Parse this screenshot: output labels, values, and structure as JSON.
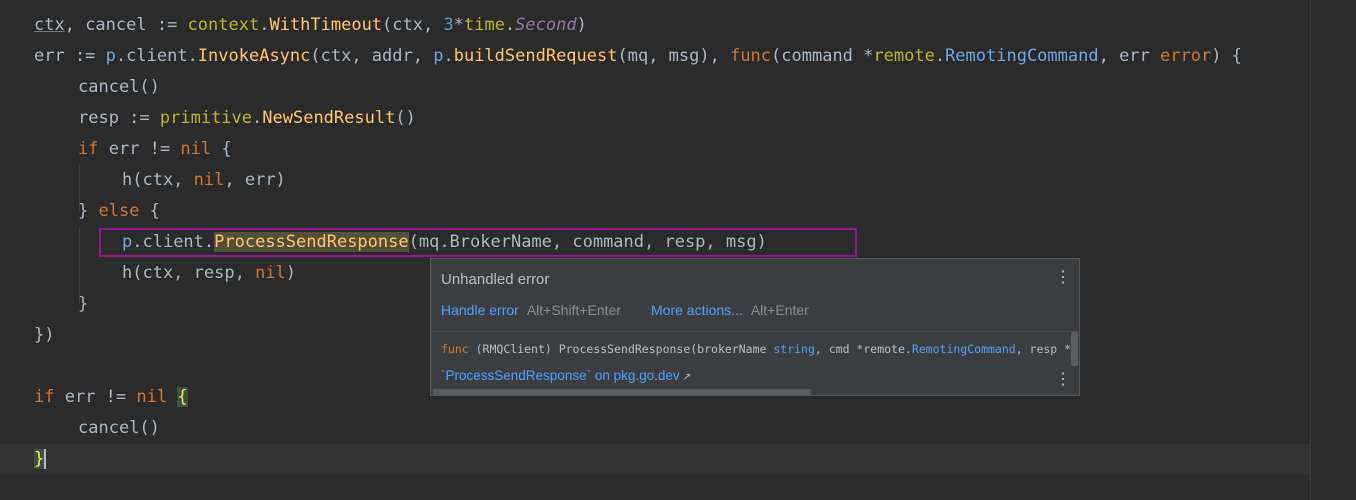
{
  "editor": {
    "lines": [
      [
        "ctx",
        ", cancel := ",
        "context",
        ".",
        "WithTimeout",
        "(ctx, ",
        "3",
        "*",
        "time",
        ".",
        "Second",
        ")"
      ],
      [
        "err := ",
        "p",
        ".client.",
        "InvokeAsync",
        "(ctx, addr, ",
        "p",
        ".",
        "buildSendRequest",
        "(mq, msg), ",
        "func",
        "(command *",
        "remote",
        ".",
        "RemotingCommand",
        ", err ",
        "error",
        ") {"
      ],
      [
        "cancel()"
      ],
      [
        "resp := ",
        "primitive",
        ".",
        "NewSendResult",
        "()"
      ],
      [
        "if",
        " err != ",
        "nil",
        " {"
      ],
      [
        "h(ctx, ",
        "nil",
        ", err)"
      ],
      [
        "} ",
        "else",
        " {"
      ],
      [
        "p",
        ".client.",
        "ProcessSendResponse",
        "(mq.BrokerName, command, resp, msg)"
      ],
      [
        "h(ctx, resp, ",
        "nil",
        ")"
      ],
      [
        "}"
      ],
      [
        "})"
      ],
      [
        ""
      ],
      [
        "if",
        " err != ",
        "nil",
        " ",
        "{"
      ],
      [
        "cancel()"
      ],
      [
        "}"
      ]
    ]
  },
  "popup": {
    "title": "Unhandled error",
    "menu_icon": "⋮",
    "action1_label": "Handle error",
    "action1_shortcut": "Alt+Shift+Enter",
    "action2_label": "More actions...",
    "action2_shortcut": "Alt+Enter",
    "signature": {
      "kw_func": "func",
      "receiver": " (RMQClient) ProcessSendResponse(brokerName ",
      "type_string": "string",
      "after_string": ", cmd *remote.",
      "type_remoting": "RemotingCommand",
      "tail": ", resp *p"
    },
    "doc_link": "`ProcessSendResponse` on pkg.go.dev",
    "doc_link_icon": "↗"
  }
}
